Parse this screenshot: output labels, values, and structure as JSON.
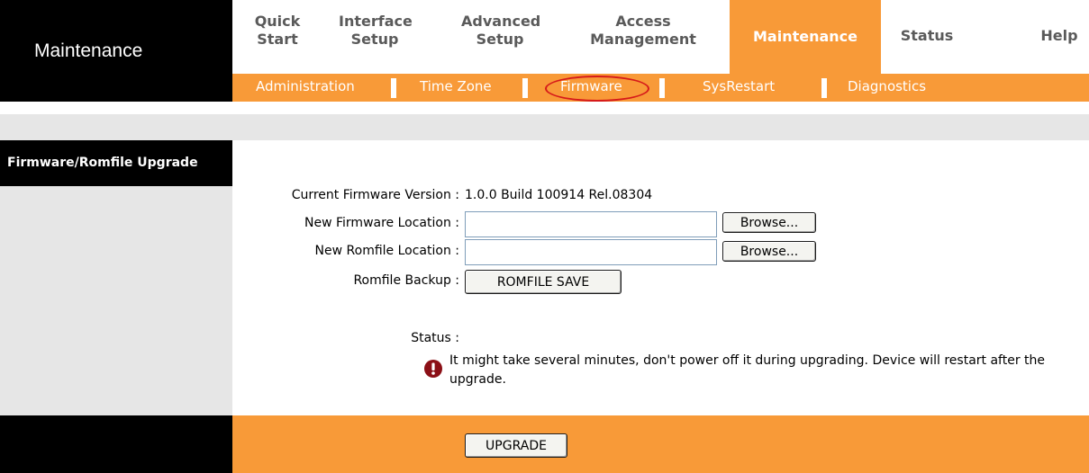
{
  "header": {
    "title": "Maintenance"
  },
  "nav": {
    "items": [
      {
        "label": "Quick Start"
      },
      {
        "label": "Interface Setup"
      },
      {
        "label": "Advanced Setup"
      },
      {
        "label": "Access Management"
      },
      {
        "label": "Maintenance",
        "active": true
      },
      {
        "label": "Status"
      },
      {
        "label": "Help"
      }
    ]
  },
  "subnav": {
    "items": [
      {
        "label": "Administration"
      },
      {
        "label": "Time Zone"
      },
      {
        "label": "Firmware",
        "active": true,
        "highlighted": true
      },
      {
        "label": "SysRestart"
      },
      {
        "label": "Diagnostics"
      }
    ]
  },
  "section": {
    "title": "Firmware/Romfile Upgrade"
  },
  "form": {
    "current_firmware_label": "Current Firmware Version :",
    "current_firmware_value": "1.0.0 Build 100914 Rel.08304",
    "new_firmware_label": "New Firmware Location :",
    "new_firmware_value": "",
    "new_romfile_label": "New Romfile Location :",
    "new_romfile_value": "",
    "browse_label": "Browse...",
    "romfile_backup_label": "Romfile Backup :",
    "romfile_save_label": "ROMFILE SAVE",
    "status_label": "Status :",
    "status_message": "It might take several minutes, don't power off it during upgrading. Device will restart after the upgrade."
  },
  "footer": {
    "upgrade_label": "UPGRADE"
  },
  "colors": {
    "accent": "#f89a38",
    "panel_gray": "#e6e6e6",
    "nav_text": "#5a5a5a",
    "highlight_red": "#d61a1a",
    "alert_red": "#8b0f16"
  }
}
